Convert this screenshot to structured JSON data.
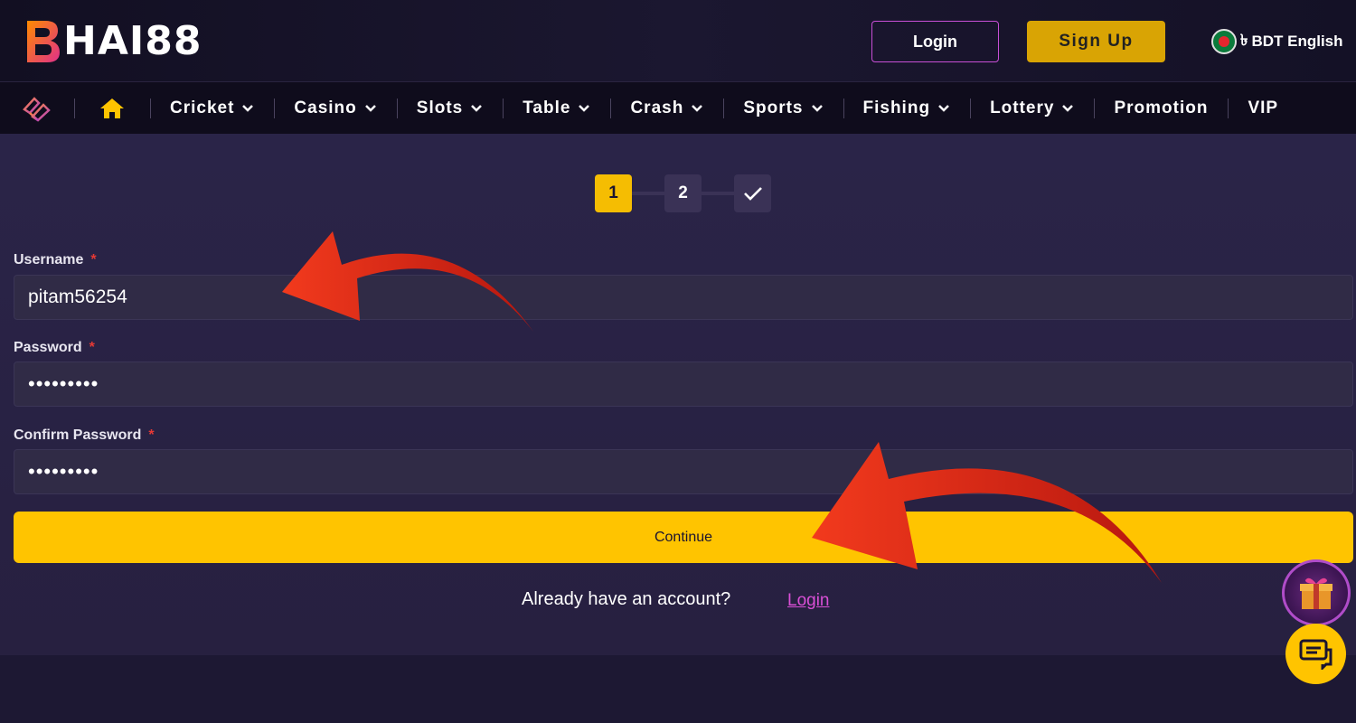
{
  "header": {
    "logo_text": "HAI88",
    "login_label": "Login",
    "signup_label": "Sign Up",
    "currency_symbol": "৳",
    "language_label": "BDT English"
  },
  "nav": {
    "items": [
      {
        "label": "Cricket",
        "dropdown": true
      },
      {
        "label": "Casino",
        "dropdown": true
      },
      {
        "label": "Slots",
        "dropdown": true
      },
      {
        "label": "Table",
        "dropdown": true
      },
      {
        "label": "Crash",
        "dropdown": true
      },
      {
        "label": "Sports",
        "dropdown": true
      },
      {
        "label": "Fishing",
        "dropdown": true
      },
      {
        "label": "Lottery",
        "dropdown": true
      },
      {
        "label": "Promotion",
        "dropdown": false
      },
      {
        "label": "VIP",
        "dropdown": false
      }
    ]
  },
  "steps": {
    "step1": "1",
    "step2": "2",
    "step3_icon": "check-icon"
  },
  "form": {
    "username_label": "Username",
    "username_value": "pitam56254",
    "password_label": "Password",
    "password_value": "•••••••••",
    "confirm_label": "Confirm Password",
    "confirm_value": "•••••••••",
    "required_mark": "*",
    "continue_label": "Continue",
    "already_text": "Already have an account?",
    "login_link": "Login"
  },
  "colors": {
    "accent_yellow": "#ffc400",
    "accent_purple": "#c84fd6",
    "background": "#1d1833",
    "panel": "#2a2448",
    "annotation_arrow": "#e8291c"
  }
}
